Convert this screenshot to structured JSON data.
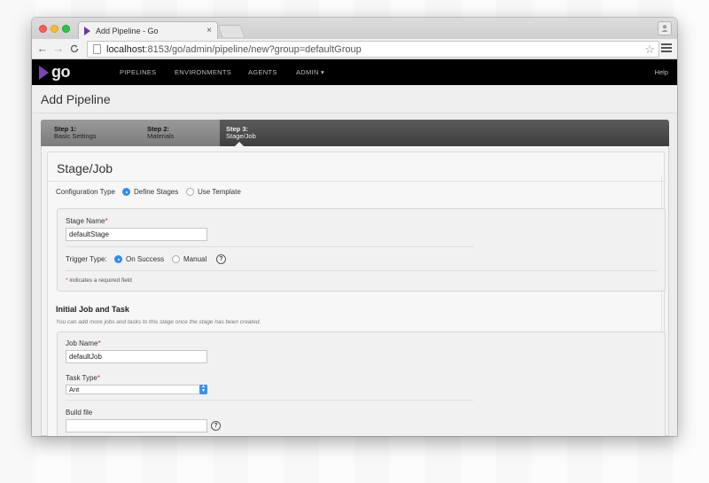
{
  "browser": {
    "tab_title": "Add Pipeline - Go",
    "tab_close": "×",
    "url_host": "localhost",
    "url_path": ":8153/go/admin/pipeline/new?group=defaultGroup",
    "back_icon": "←",
    "forward_icon": "→",
    "reload_icon": "C",
    "star_icon": "☆",
    "profile_icon": "👤"
  },
  "header": {
    "logo_text": "go",
    "nav": [
      "PIPELINES",
      "ENVIRONMENTS",
      "AGENTS",
      "ADMIN ▾"
    ],
    "help": "Help"
  },
  "page": {
    "title": "Add Pipeline"
  },
  "wizard": {
    "steps": [
      {
        "num": "Step 1:",
        "label": "Basic Settings"
      },
      {
        "num": "Step 2:",
        "label": "Materials"
      },
      {
        "num": "Step 3:",
        "label": "Stage/Job"
      }
    ]
  },
  "stage_job": {
    "title": "Stage/Job",
    "config_type_label": "Configuration Type",
    "options": [
      "Define Stages",
      "Use Template"
    ],
    "stage_name_label": "Stage Name",
    "required_mark": "*",
    "stage_name_value": "defaultStage",
    "trigger_label": "Trigger Type:",
    "trigger_options": [
      "On Success",
      "Manual"
    ],
    "help_glyph": "?",
    "required_note_mark": "*",
    "required_note": " indicates a required field"
  },
  "job": {
    "heading": "Initial Job and Task",
    "hint": "You can add more jobs and tasks to this stage once the stage has been created.",
    "job_name_label": "Job Name",
    "job_name_value": "defaultJob",
    "task_type_label": "Task Type",
    "task_type_value": "Ant",
    "build_file_label": "Build file",
    "build_file_value": ""
  }
}
